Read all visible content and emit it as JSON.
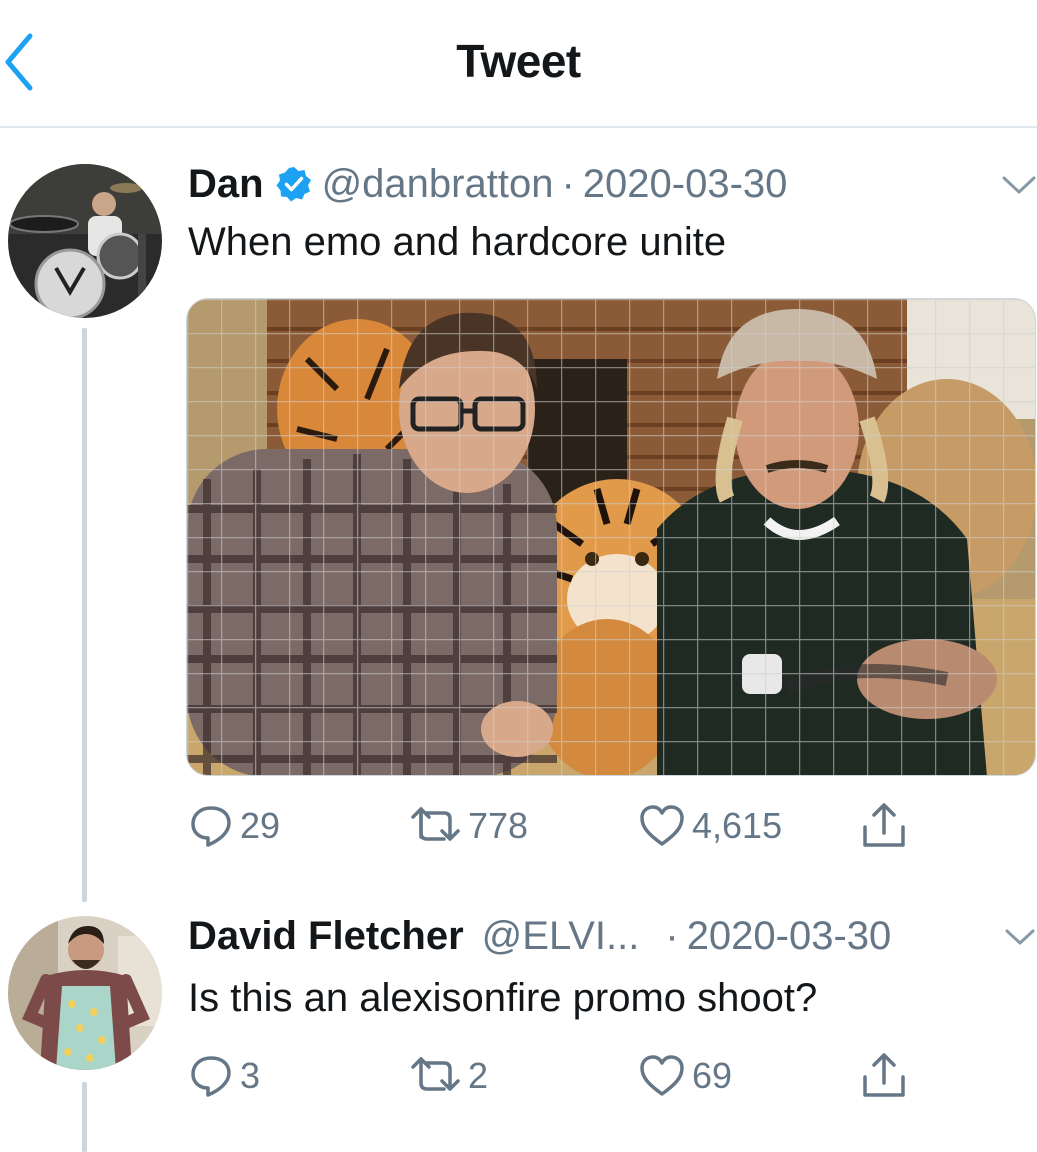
{
  "header": {
    "title": "Tweet",
    "back_icon": "chevron-left-icon",
    "accent_color": "#1da1f2"
  },
  "tweets": [
    {
      "name": "Dan",
      "verified": true,
      "handle": "@danbratton",
      "separator": "·",
      "date": "2020-03-30",
      "text": "When emo and hardcore unite",
      "media": "photo",
      "stats": {
        "replies": "29",
        "retweets": "778",
        "likes": "4,615"
      }
    },
    {
      "name": "David Fletcher",
      "verified": false,
      "handle": "@ELVI...",
      "separator": "·",
      "date": "2020-03-30",
      "text": "Is this an alexisonfire promo shoot?",
      "stats": {
        "replies": "3",
        "retweets": "2",
        "likes": "69"
      }
    }
  ],
  "icons": {
    "reply": "reply-icon",
    "retweet": "retweet-icon",
    "like": "heart-icon",
    "share": "share-icon",
    "more": "chevron-down-icon",
    "verified": "verified-badge-icon"
  },
  "colors": {
    "text": "#14171a",
    "secondary": "#657786",
    "divider": "#e1e8ed",
    "thread_line": "#ccd6dd",
    "verified": "#1da1f2"
  }
}
